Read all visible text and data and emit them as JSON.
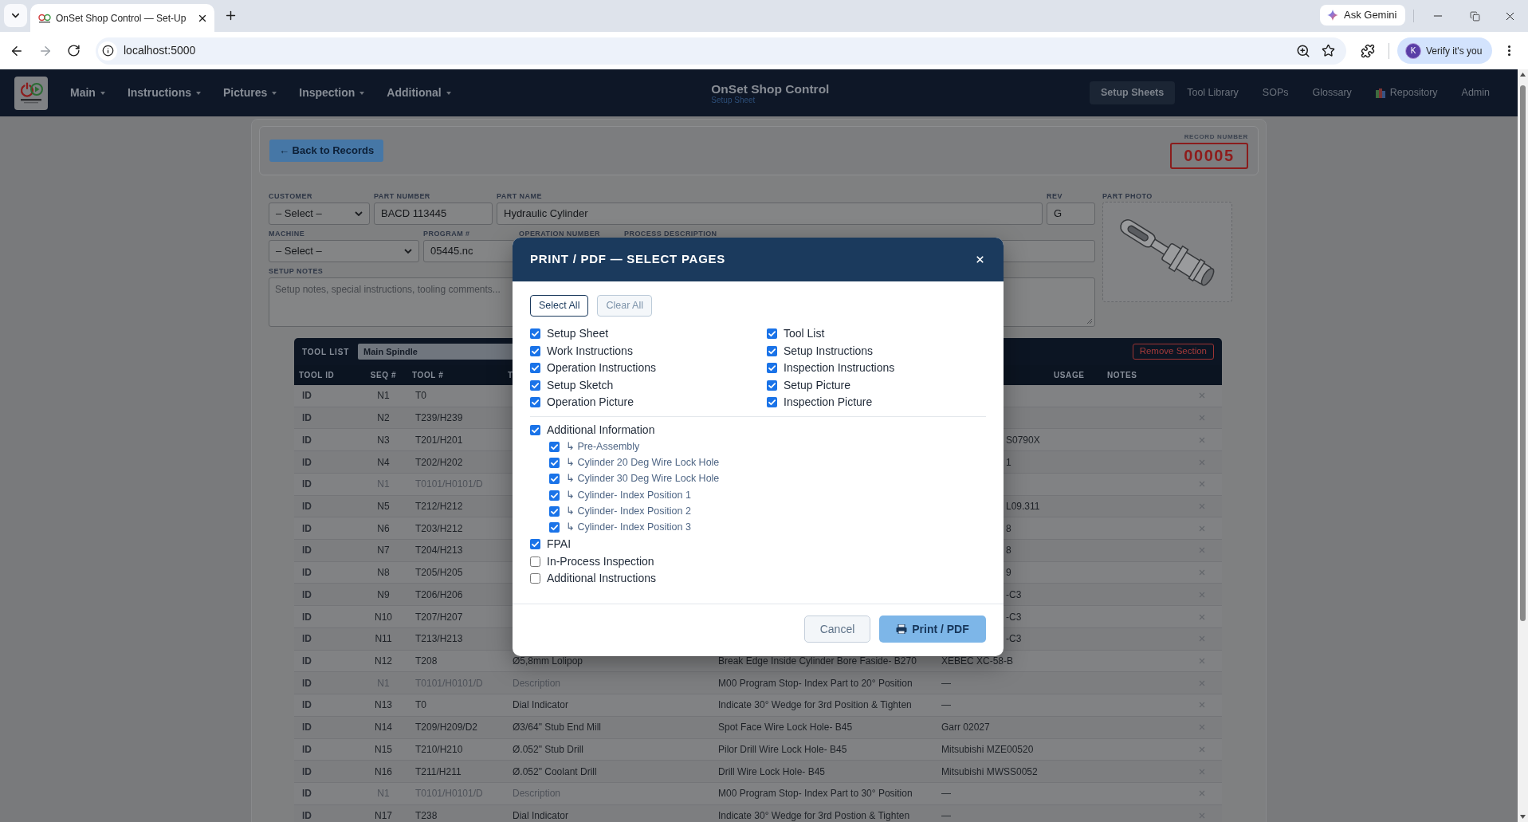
{
  "browser": {
    "tab_title": "OnSet Shop Control — Set-Up",
    "assistant_button": "Ask Gemini",
    "url": "localhost:5000",
    "profile_initial": "K",
    "profile_label": "Verify it's you"
  },
  "nav": {
    "menus": [
      {
        "label": "Main"
      },
      {
        "label": "Instructions"
      },
      {
        "label": "Pictures"
      },
      {
        "label": "Inspection"
      },
      {
        "label": "Additional"
      }
    ],
    "title": "OnSet Shop Control",
    "subtitle": "Setup Sheet",
    "links": [
      {
        "label": "Setup Sheets",
        "selected": true,
        "kind": "text"
      },
      {
        "label": "Tool Library",
        "selected": false,
        "kind": "text"
      },
      {
        "label": "SOPs",
        "selected": false,
        "kind": "text"
      },
      {
        "label": "Glossary",
        "selected": false,
        "kind": "text"
      },
      {
        "label": "Repository",
        "selected": false,
        "kind": "icon"
      },
      {
        "label": "Admin",
        "selected": false,
        "kind": "text"
      }
    ]
  },
  "record_bar": {
    "back_button": "← Back to Records",
    "record_label": "RECORD NUMBER",
    "record_number": "00005"
  },
  "form": {
    "rows": [
      [
        {
          "label": "CUSTOMER",
          "kind": "select",
          "value": "– Select –"
        },
        {
          "label": "PART NUMBER",
          "kind": "text",
          "value": "BACD 113445"
        },
        {
          "label": "PART NAME",
          "kind": "text",
          "value": "Hydraulic Cylinder"
        },
        {
          "label": "REV",
          "kind": "text",
          "value": "G"
        }
      ],
      [
        {
          "label": "MACHINE",
          "kind": "select",
          "value": "– Select –"
        },
        {
          "label": "PROGRAM #",
          "kind": "text",
          "value": "05445.nc"
        },
        {
          "label": "OPERATION NUMBER",
          "kind": "covered"
        },
        {
          "label": "PROCESS DESCRIPTION",
          "kind": "text"
        }
      ]
    ],
    "notes": {
      "label": "SETUP NOTES",
      "placeholder": "Setup notes, special instructions, tooling comments..."
    },
    "photo": {
      "label": "PART PHOTO"
    }
  },
  "tool_list": {
    "label": "TOOL LIST",
    "section_name": "Main Spindle",
    "remove_button": "Remove Section",
    "columns": [
      {
        "label": "TOOL ID"
      },
      {
        "label": "SEQ #"
      },
      {
        "label": "TOOL #"
      },
      {
        "label": "T"
      },
      {
        "label": "USAGE"
      },
      {
        "label": "NOTES"
      }
    ],
    "rows": [
      {
        "kind": "tool",
        "tool_id": "ID",
        "seq": "N1",
        "tool_no": "T0"
      },
      {
        "kind": "tool",
        "tool_id": "ID",
        "seq": "N2",
        "tool_no": "T239/H239"
      },
      {
        "kind": "tool",
        "tool_id": "ID",
        "seq": "N3",
        "tool_no": "T201/H201",
        "holder": "S0790X"
      },
      {
        "kind": "tool",
        "tool_id": "ID",
        "seq": "N4",
        "tool_no": "T202/H202",
        "holder": "1"
      },
      {
        "kind": "stop",
        "tool_id": "ID",
        "seq": "N1",
        "tool_no": "T0101/H0101/D"
      },
      {
        "kind": "tool",
        "tool_id": "ID",
        "seq": "N5",
        "tool_no": "T212/H212",
        "holder": "L09.311"
      },
      {
        "kind": "tool",
        "tool_id": "ID",
        "seq": "N6",
        "tool_no": "T203/H212",
        "holder": "8"
      },
      {
        "kind": "tool",
        "tool_id": "ID",
        "seq": "N7",
        "tool_no": "T204/H213",
        "holder": "8"
      },
      {
        "kind": "tool",
        "tool_id": "ID",
        "seq": "N8",
        "tool_no": "T205/H205",
        "holder": "9"
      },
      {
        "kind": "tool",
        "tool_id": "ID",
        "seq": "N9",
        "tool_no": "T206/H206",
        "holder": "-C3"
      },
      {
        "kind": "tool",
        "tool_id": "ID",
        "seq": "N10",
        "tool_no": "T207/H207",
        "holder": "-C3"
      },
      {
        "kind": "tool",
        "tool_id": "ID",
        "seq": "N11",
        "tool_no": "T213/H213",
        "holder": "-C3"
      },
      {
        "kind": "tool",
        "tool_id": "ID",
        "seq": "N12",
        "tool_no": "T208",
        "description": "Ø5,8mm Lolipop",
        "operation": "Break Edge Inside Cylinder Bore Faside- B270",
        "holder": "XEBEC XC-58-B"
      },
      {
        "kind": "stop",
        "tool_id": "ID",
        "seq": "N1",
        "tool_no": "T0101/H0101/D",
        "description": "Description",
        "operation": "M00 Program Stop- Index Part to 20° Position",
        "holder": "—"
      },
      {
        "kind": "tool",
        "tool_id": "ID",
        "seq": "N13",
        "tool_no": "T0",
        "description": "Dial Indicator",
        "operation": "Indicate 30° Wedge for 3rd Position & Tighten",
        "holder": "—"
      },
      {
        "kind": "tool",
        "tool_id": "ID",
        "seq": "N14",
        "tool_no": "T209/H209/D2",
        "description": "Ø3/64\" Stub End Mill",
        "operation": "Spot Face Wire Lock Hole- B45",
        "holder": "Garr 02027"
      },
      {
        "kind": "tool",
        "tool_id": "ID",
        "seq": "N15",
        "tool_no": "T210/H210",
        "description": "Ø.052\" Stub Drill",
        "operation": "Pilor Drill Wire Lock Hole- B45",
        "holder": "Mitsubishi MZE00520"
      },
      {
        "kind": "tool",
        "tool_id": "ID",
        "seq": "N16",
        "tool_no": "T211/H211",
        "description": "Ø.052\" Coolant Drill",
        "operation": "Drill Wire Lock Hole- B45",
        "holder": "Mitsubishi MWSS0052"
      },
      {
        "kind": "stop",
        "tool_id": "ID",
        "seq": "N1",
        "tool_no": "T0101/H0101/D",
        "description": "Description",
        "operation": "M00 Program Stop- Index Part to 30° Position",
        "holder": "—"
      },
      {
        "kind": "tool",
        "tool_id": "ID",
        "seq": "N17",
        "tool_no": "T238",
        "description": "Dial Indicator",
        "operation": "Indicate 30° Wedge for 3rd Postion & Tighten",
        "holder": "—"
      }
    ]
  },
  "dialog": {
    "title": "PRINT / PDF — SELECT PAGES",
    "top_buttons": [
      {
        "label": "Select All",
        "kind": "primary"
      },
      {
        "label": "Clear All",
        "kind": "secondary"
      }
    ],
    "pages": [
      {
        "label": "Setup Sheet",
        "checked": true
      },
      {
        "label": "Tool List",
        "checked": true
      },
      {
        "label": "Work Instructions",
        "checked": true
      },
      {
        "label": "Setup Instructions",
        "checked": true
      },
      {
        "label": "Operation Instructions",
        "checked": true
      },
      {
        "label": "Inspection Instructions",
        "checked": true
      },
      {
        "label": "Setup Sketch",
        "checked": true
      },
      {
        "label": "Setup Picture",
        "checked": true
      },
      {
        "label": "Operation Picture",
        "checked": true
      },
      {
        "label": "Inspection Picture",
        "checked": true
      }
    ],
    "extras": [
      {
        "label": "Additional Information",
        "checked": true,
        "children": [
          {
            "label": "↳ Pre-Assembly",
            "checked": true
          },
          {
            "label": "↳ Cylinder 20 Deg Wire Lock Hole",
            "checked": true
          },
          {
            "label": "↳ Cylinder 30 Deg Wire Lock Hole",
            "checked": true
          },
          {
            "label": "↳ Cylinder- Index Position 1",
            "checked": true
          },
          {
            "label": "↳ Cylinder- Index Position 2",
            "checked": true
          },
          {
            "label": "↳ Cylinder- Index Position 3",
            "checked": true
          }
        ]
      },
      {
        "label": "FPAI",
        "checked": true
      },
      {
        "label": "In-Process Inspection",
        "checked": false
      },
      {
        "label": "Additional Instructions",
        "checked": false
      }
    ],
    "buttons": [
      {
        "label": "Cancel",
        "kind": "secondary"
      },
      {
        "label": "Print / PDF",
        "kind": "primary"
      }
    ]
  }
}
